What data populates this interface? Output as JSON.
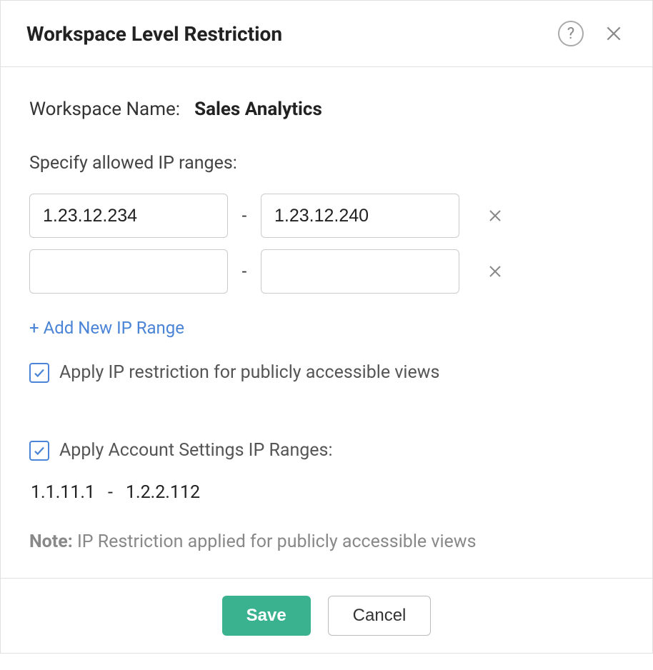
{
  "dialog": {
    "title": "Workspace Level Restriction"
  },
  "workspace": {
    "label": "Workspace Name:",
    "value": "Sales Analytics"
  },
  "ip_section": {
    "label": "Specify allowed IP ranges:",
    "ranges": [
      {
        "from": "1.23.12.234",
        "to": "1.23.12.240"
      },
      {
        "from": "",
        "to": ""
      }
    ],
    "add_link": "+ Add New IP Range"
  },
  "checkboxes": {
    "public_views": {
      "checked": true,
      "label": "Apply IP restriction for publicly accessible views"
    },
    "account_ranges": {
      "checked": true,
      "label": "Apply Account Settings IP Ranges:"
    }
  },
  "account_range": {
    "from": "1.1.11.1",
    "dash": "-",
    "to": "1.2.2.112"
  },
  "note": {
    "label": "Note:",
    "text": " IP Restriction applied for publicly accessible views"
  },
  "footer": {
    "save": "Save",
    "cancel": "Cancel"
  },
  "symbols": {
    "dash": "-",
    "question": "?"
  }
}
